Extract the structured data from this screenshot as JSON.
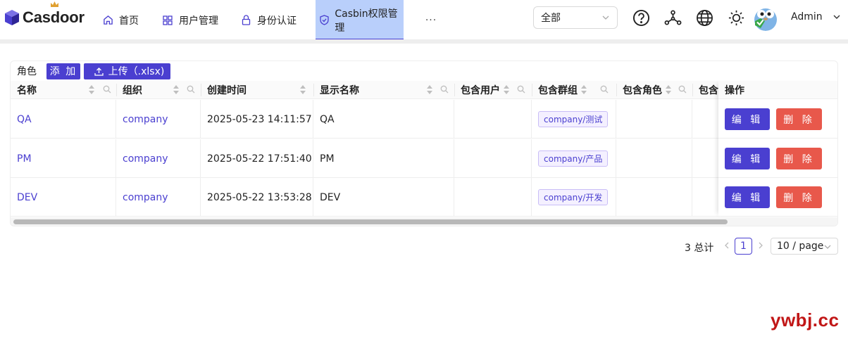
{
  "app": {
    "brand": "Casdoor",
    "accent_color": "#4a3fd0",
    "danger_color": "#e8584b"
  },
  "nav": {
    "items": [
      {
        "label": "首页",
        "icon": "home-icon"
      },
      {
        "label": "用户管理",
        "icon": "grid-icon"
      },
      {
        "label": "身份认证",
        "icon": "lock-icon"
      },
      {
        "label": "Casbin权限管理",
        "icon": "shield-icon",
        "active": true
      }
    ],
    "more": "···"
  },
  "header": {
    "org_select": "全部",
    "user_name": "Admin",
    "icons": [
      "help-icon",
      "share-nodes-icon",
      "globe-icon",
      "sun-icon"
    ]
  },
  "toolbar": {
    "title": "角色",
    "add_label": "添 加",
    "upload_label": "上传（.xlsx)"
  },
  "table": {
    "columns": [
      "名称",
      "组织",
      "创建时间",
      "显示名称",
      "包含用户",
      "包含群组",
      "包含角色",
      "包含"
    ],
    "action_header": "操作",
    "rows": [
      {
        "name": "QA",
        "org": "company",
        "created": "2025-05-23 14:11:57",
        "display": "QA",
        "users": "",
        "groups": "company/测试",
        "roles": ""
      },
      {
        "name": "PM",
        "org": "company",
        "created": "2025-05-22 17:51:40",
        "display": "PM",
        "users": "",
        "groups": "company/产品",
        "roles": ""
      },
      {
        "name": "DEV",
        "org": "company",
        "created": "2025-05-22 13:53:28",
        "display": "DEV",
        "users": "",
        "groups": "company/开发",
        "roles": ""
      }
    ],
    "edit_label": "编 辑",
    "delete_label": "删 除"
  },
  "pagination": {
    "total": "3 总计",
    "current": "1",
    "page_size": "10 / page"
  },
  "watermark": "ywbj.cc"
}
